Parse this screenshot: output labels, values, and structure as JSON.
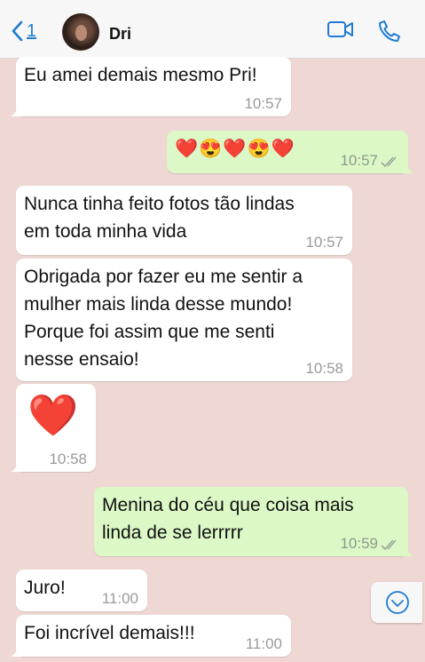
{
  "header": {
    "back_count": "1",
    "contact_name": "Dri"
  },
  "colors": {
    "accent": "#1e7bd4",
    "background": "#efd8d3",
    "incoming": "#ffffff",
    "outgoing": "#dcf8c6"
  },
  "icons": {
    "back": "chevron-left-icon",
    "video": "video-camera-icon",
    "call": "phone-icon",
    "scroll": "chevron-down-icon",
    "read": "double-check-icon"
  },
  "messages": [
    {
      "dir": "in",
      "text": "Eu amei demais mesmo Pri!",
      "time": "10:57"
    },
    {
      "dir": "out",
      "text": "❤️😍❤️😍❤️",
      "time": "10:57",
      "read": true
    },
    {
      "dir": "in",
      "lines": [
        "Nunca tinha feito fotos tão lindas",
        "em toda minha vida"
      ],
      "time": "10:57"
    },
    {
      "dir": "in",
      "lines": [
        "Obrigada por fazer eu me sentir a",
        "mulher mais linda desse mundo!",
        "Porque foi assim que me senti",
        "nesse ensaio!"
      ],
      "time": "10:58"
    },
    {
      "dir": "in",
      "text": "❤️",
      "time": "10:58"
    },
    {
      "dir": "out",
      "lines": [
        "Menina do céu que coisa mais",
        "linda de se lerrrrr"
      ],
      "time": "10:59",
      "read": true
    },
    {
      "dir": "in",
      "text": "Juro!",
      "time": "11:00"
    },
    {
      "dir": "in",
      "text": "Foi incrível demais!!!",
      "time": "11:00"
    }
  ]
}
